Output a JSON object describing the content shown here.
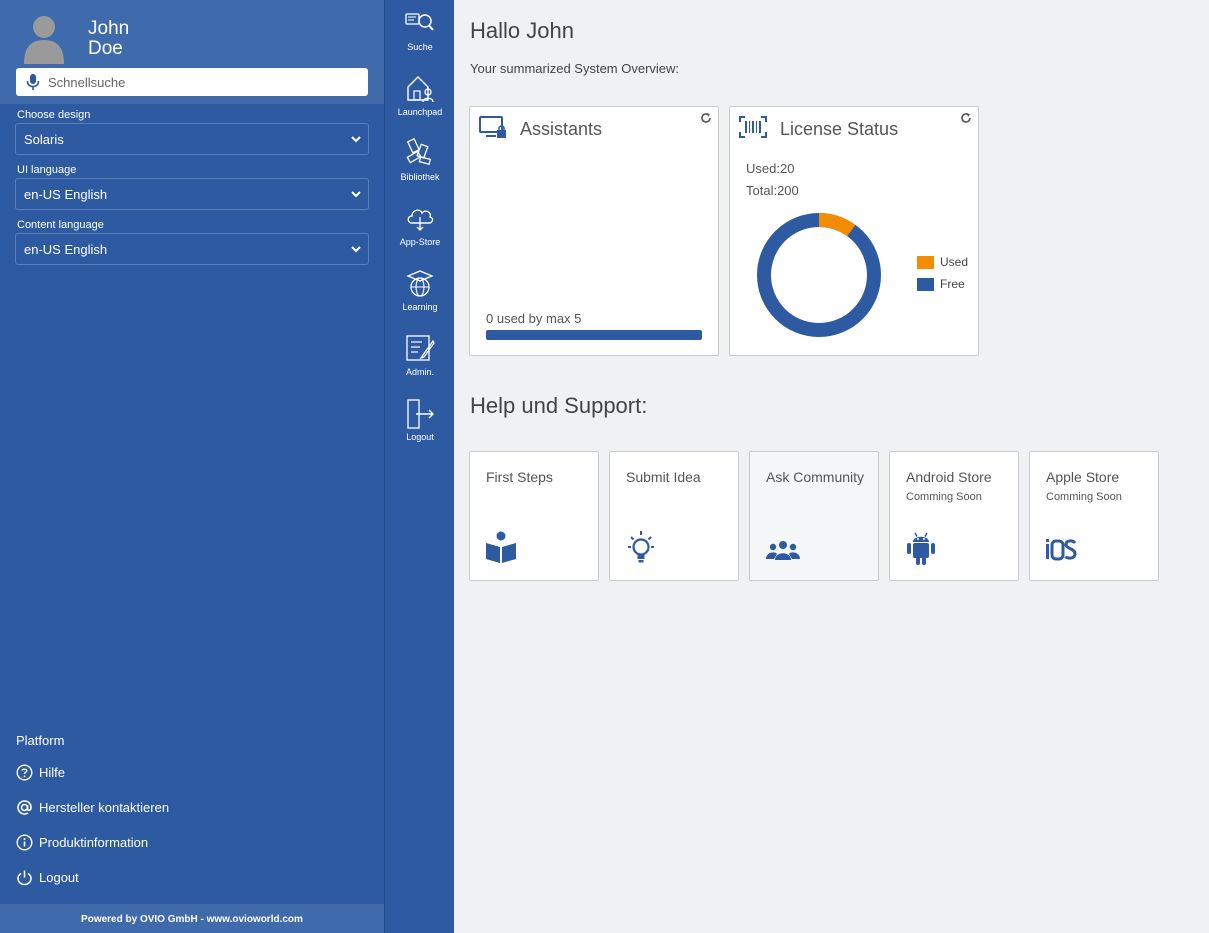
{
  "user": {
    "first_name": "John",
    "last_name": "Doe"
  },
  "search": {
    "placeholder": "Schnellsuche"
  },
  "settings": [
    {
      "label": "Choose design",
      "value": "Solaris"
    },
    {
      "label": "UI language",
      "value": "en-US English"
    },
    {
      "label": "Content language",
      "value": "en-US English"
    }
  ],
  "platform": {
    "title": "Platform",
    "links": [
      {
        "label": "Hilfe",
        "icon": "question-circle-icon"
      },
      {
        "label": "Hersteller kontaktieren",
        "icon": "at-sign-icon"
      },
      {
        "label": "Produktinformation",
        "icon": "info-circle-icon"
      },
      {
        "label": "Logout",
        "icon": "power-icon"
      }
    ]
  },
  "footer": {
    "text": "Powered by OVIO GmbH - www.ovioworld.com"
  },
  "nav": [
    {
      "label": "Suche",
      "icon": "search-icon"
    },
    {
      "label": "Launchpad",
      "icon": "launchpad-icon"
    },
    {
      "label": "Bibliothek",
      "icon": "library-icon"
    },
    {
      "label": "App-Store",
      "icon": "cloud-store-icon"
    },
    {
      "label": "Learning",
      "icon": "learning-icon"
    },
    {
      "label": "Admin.",
      "icon": "admin-icon"
    },
    {
      "label": "Logout",
      "icon": "logout-icon"
    }
  ],
  "main": {
    "greeting": "Hallo John",
    "overview": "Your summarized System Overview:",
    "assistants": {
      "title": "Assistants",
      "usage_text": "0 used by max 5",
      "used": 0,
      "max": 5,
      "bar_fill": 1.0
    },
    "license": {
      "title": "License Status",
      "used_label": "Used:20",
      "total_label": "Total:200",
      "used": 20,
      "total": 200,
      "legend": [
        {
          "label": "Used",
          "color": "#f28c00"
        },
        {
          "label": "Free",
          "color": "#2d5aa0"
        }
      ]
    },
    "help_heading": "Help und Support:",
    "help_cards": [
      {
        "title": "First Steps",
        "subtitle": "",
        "icon": "book-reader-icon"
      },
      {
        "title": "Submit Idea",
        "subtitle": "",
        "icon": "lightbulb-icon"
      },
      {
        "title": "Ask Community",
        "subtitle": "",
        "icon": "users-icon"
      },
      {
        "title": "Android Store",
        "subtitle": "Comming Soon",
        "icon": "android-icon"
      },
      {
        "title": "Apple Store",
        "subtitle": "Comming Soon",
        "icon": "ios-icon"
      }
    ]
  },
  "colors": {
    "primary": "#2d5aa0",
    "header": "#3f6aac",
    "accent": "#f28c00",
    "background": "#f0f1f3"
  }
}
